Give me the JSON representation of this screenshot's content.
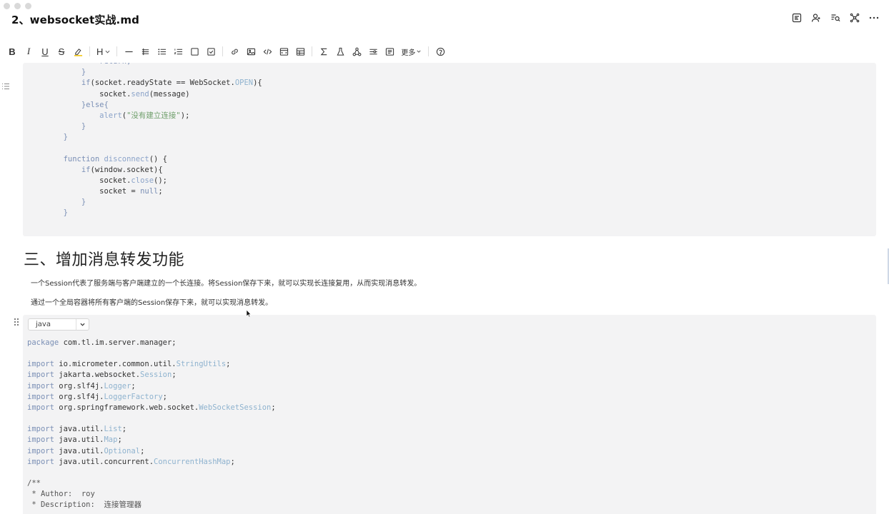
{
  "document": {
    "title": "2、websocket实战.md"
  },
  "toolbar": {
    "bold": "B",
    "italic": "I",
    "underline": "U",
    "strike": "S",
    "heading": "H",
    "more_label": "更多"
  },
  "code_block_top": {
    "lines": [
      {
        "indent": "                ",
        "parts": [
          {
            "t": "return;",
            "c": "kw"
          }
        ]
      },
      {
        "indent": "            ",
        "parts": [
          {
            "t": "}",
            "c": "kw"
          }
        ]
      },
      {
        "indent": "            ",
        "parts": [
          {
            "t": "if",
            "c": "kw"
          },
          {
            "t": "(socket.readyState == WebSocket.",
            "c": ""
          },
          {
            "t": "OPEN",
            "c": "cl"
          },
          {
            "t": "){",
            "c": ""
          }
        ]
      },
      {
        "indent": "                ",
        "parts": [
          {
            "t": "socket.",
            "c": ""
          },
          {
            "t": "send",
            "c": "fn"
          },
          {
            "t": "(message)",
            "c": ""
          }
        ]
      },
      {
        "indent": "            ",
        "parts": [
          {
            "t": "}else{",
            "c": "kw"
          }
        ]
      },
      {
        "indent": "                ",
        "parts": [
          {
            "t": "alert",
            "c": "fn"
          },
          {
            "t": "(",
            "c": ""
          },
          {
            "t": "\"没有建立连接\"",
            "c": "str"
          },
          {
            "t": ");",
            "c": ""
          }
        ]
      },
      {
        "indent": "            ",
        "parts": [
          {
            "t": "}",
            "c": "kw"
          }
        ]
      },
      {
        "indent": "        ",
        "parts": [
          {
            "t": "}",
            "c": "kw"
          }
        ]
      },
      {
        "indent": "",
        "parts": [
          {
            "t": "",
            "c": ""
          }
        ]
      },
      {
        "indent": "        ",
        "parts": [
          {
            "t": "function",
            "c": "kw"
          },
          {
            "t": " ",
            "c": ""
          },
          {
            "t": "disconnect",
            "c": "fn"
          },
          {
            "t": "() {",
            "c": ""
          }
        ]
      },
      {
        "indent": "            ",
        "parts": [
          {
            "t": "if",
            "c": "kw"
          },
          {
            "t": "(window.socket){",
            "c": ""
          }
        ]
      },
      {
        "indent": "                ",
        "parts": [
          {
            "t": "socket.",
            "c": ""
          },
          {
            "t": "close",
            "c": "fn"
          },
          {
            "t": "();",
            "c": ""
          }
        ]
      },
      {
        "indent": "                ",
        "parts": [
          {
            "t": "socket = ",
            "c": ""
          },
          {
            "t": "null",
            "c": "kw"
          },
          {
            "t": ";",
            "c": ""
          }
        ]
      },
      {
        "indent": "            ",
        "parts": [
          {
            "t": "}",
            "c": "kw"
          }
        ]
      },
      {
        "indent": "        ",
        "parts": [
          {
            "t": "}",
            "c": "kw"
          }
        ]
      }
    ]
  },
  "section": {
    "heading": "三、增加消息转发功能",
    "paragraph_1": "一个Session代表了服务端与客户端建立的一个长连接。将Session保存下来，就可以实现长连接复用，从而实现消息转发。",
    "paragraph_2": "通过一个全局容器将所有客户端的Session保存下来，就可以实现消息转发。"
  },
  "code_block_bottom": {
    "language": "java",
    "lines": [
      [
        {
          "t": "package",
          "c": "kw"
        },
        {
          "t": " com.tl.im.server.manager;",
          "c": ""
        }
      ],
      [
        {
          "t": "",
          "c": ""
        }
      ],
      [
        {
          "t": "import",
          "c": "kw"
        },
        {
          "t": " io.micrometer.common.util.",
          "c": ""
        },
        {
          "t": "StringUtils",
          "c": "cl"
        },
        {
          "t": ";",
          "c": ""
        }
      ],
      [
        {
          "t": "import",
          "c": "kw"
        },
        {
          "t": " jakarta.websocket.",
          "c": ""
        },
        {
          "t": "Session",
          "c": "cl"
        },
        {
          "t": ";",
          "c": ""
        }
      ],
      [
        {
          "t": "import",
          "c": "kw"
        },
        {
          "t": " org.slf4j.",
          "c": ""
        },
        {
          "t": "Logger",
          "c": "cl"
        },
        {
          "t": ";",
          "c": ""
        }
      ],
      [
        {
          "t": "import",
          "c": "kw"
        },
        {
          "t": " org.slf4j.",
          "c": ""
        },
        {
          "t": "LoggerFactory",
          "c": "cl"
        },
        {
          "t": ";",
          "c": ""
        }
      ],
      [
        {
          "t": "import",
          "c": "kw"
        },
        {
          "t": " org.springframework.web.socket.",
          "c": ""
        },
        {
          "t": "WebSocketSession",
          "c": "cl"
        },
        {
          "t": ";",
          "c": ""
        }
      ],
      [
        {
          "t": "",
          "c": ""
        }
      ],
      [
        {
          "t": "import",
          "c": "kw"
        },
        {
          "t": " java.util.",
          "c": ""
        },
        {
          "t": "List",
          "c": "cl"
        },
        {
          "t": ";",
          "c": ""
        }
      ],
      [
        {
          "t": "import",
          "c": "kw"
        },
        {
          "t": " java.util.",
          "c": ""
        },
        {
          "t": "Map",
          "c": "cl"
        },
        {
          "t": ";",
          "c": ""
        }
      ],
      [
        {
          "t": "import",
          "c": "kw"
        },
        {
          "t": " java.util.",
          "c": ""
        },
        {
          "t": "Optional",
          "c": "cl"
        },
        {
          "t": ";",
          "c": ""
        }
      ],
      [
        {
          "t": "import",
          "c": "kw"
        },
        {
          "t": " java.util.concurrent.",
          "c": ""
        },
        {
          "t": "ConcurrentHashMap",
          "c": "cl"
        },
        {
          "t": ";",
          "c": ""
        }
      ],
      [
        {
          "t": "",
          "c": ""
        }
      ],
      [
        {
          "t": "/**",
          "c": "cm"
        }
      ],
      [
        {
          "t": " * Author:  roy",
          "c": "cm"
        }
      ],
      [
        {
          "t": " * Description:  连接管理器",
          "c": "cm"
        }
      ]
    ]
  }
}
